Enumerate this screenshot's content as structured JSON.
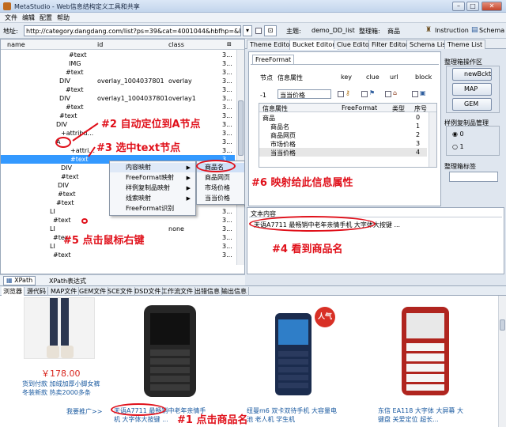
{
  "window": {
    "title": "MetaStudio - Web信息结构定义工具和共享"
  },
  "menu": [
    "文件",
    "编辑",
    "配置",
    "帮助"
  ],
  "toolbar": {
    "address_label": "地址:",
    "address_value": "http://category.dangdang.com/list?ps=39&cat=4001044&hbfhp=&lowp",
    "theme_label": "主题:",
    "theme_value": "demo_DD_list",
    "organizer_label": "整理箱:",
    "organizer_value": "商品",
    "instruction_label": "Instruction",
    "schema_label": "Schema"
  },
  "tree": {
    "headers": {
      "name": "name",
      "id": "id",
      "class": "class"
    },
    "rows": [
      {
        "name": "#text",
        "id": "",
        "class": "",
        "flag": "3..."
      },
      {
        "name": "IMG",
        "id": "",
        "class": "",
        "flag": "3..."
      },
      {
        "name": "#text",
        "id": "",
        "class": "",
        "flag": "3..."
      },
      {
        "name": "DIV",
        "id": "overlay_1004037801",
        "class": "overlay",
        "flag": "3..."
      },
      {
        "name": "#text",
        "id": "",
        "class": "",
        "flag": "3..."
      },
      {
        "name": "DIV",
        "id": "overlay1_1004037801",
        "class": "overlay1",
        "flag": "3..."
      },
      {
        "name": "#text",
        "id": "",
        "class": "",
        "flag": "3..."
      },
      {
        "name": "#text",
        "id": "",
        "class": "",
        "flag": "3..."
      },
      {
        "name": "DIV",
        "id": "",
        "class": "",
        "flag": "3..."
      },
      {
        "name": "+attribu...",
        "id": "",
        "class": "",
        "flag": "3..."
      },
      {
        "name": "A",
        "id": "",
        "class": "",
        "flag": "3..."
      },
      {
        "name": "+attri...",
        "id": "",
        "class": "",
        "flag": "3..."
      },
      {
        "name": "#text",
        "id": "",
        "class": "",
        "flag": "3..."
      },
      {
        "name": "DIV",
        "id": "",
        "class": "",
        "flag": "3..."
      },
      {
        "name": "#text",
        "id": "",
        "class": "",
        "flag": "3..."
      },
      {
        "name": "DIV",
        "id": "",
        "class": "",
        "flag": "3..."
      },
      {
        "name": "#text",
        "id": "",
        "class": "",
        "flag": "3..."
      },
      {
        "name": "#text",
        "id": "",
        "class": "",
        "flag": "3..."
      },
      {
        "name": "LI",
        "id": "",
        "class": "",
        "flag": "3..."
      },
      {
        "name": "#text",
        "id": "",
        "class": "",
        "flag": "3..."
      },
      {
        "name": "LI",
        "id": "",
        "class": "none",
        "flag": "3..."
      },
      {
        "name": "#tex",
        "id": "",
        "class": "",
        "flag": "3..."
      },
      {
        "name": "LI",
        "id": "",
        "class": "",
        "flag": "3..."
      },
      {
        "name": "#text",
        "id": "",
        "class": "",
        "flag": "3..."
      }
    ]
  },
  "context_menu": {
    "items": [
      "内容映射",
      "FreeFormat映射",
      "样例复制品映射",
      "线索映射",
      "FreeFormat识别"
    ],
    "submenu": [
      "商品名",
      "商品网页",
      "市场价格",
      "当当价格"
    ]
  },
  "left_bottom_tabs": [
    "XPath",
    "XPath表达式"
  ],
  "right_tabs": [
    "Theme Editor",
    "Bucket Editor",
    "Clue Editor",
    "Filter Editor",
    "Schema List",
    "Theme List"
  ],
  "bucket_editor": {
    "freeformat_tab": "FreeFormat",
    "cols": [
      "节点",
      "信息属性",
      "key",
      "clue",
      "url",
      "block"
    ],
    "row_index": "-1",
    "row_value": "当当价格",
    "table_headers": [
      "信息属性",
      "FreeFormat",
      "类型",
      "序号"
    ],
    "table_rows": [
      {
        "name": "商品",
        "type": "",
        "seq": "0"
      },
      {
        "name": "商品名",
        "type": "",
        "seq": "1"
      },
      {
        "name": "商品网页",
        "type": "",
        "seq": "2"
      },
      {
        "name": "市场价格",
        "type": "",
        "seq": "3"
      },
      {
        "name": "当当价格",
        "type": "",
        "seq": "4"
      }
    ]
  },
  "organizer_panel": {
    "title": "整理箱操作区",
    "buttons": [
      "newBckt",
      "MAP",
      "GEM"
    ],
    "sample_title": "样例复制品管理",
    "radio_0": "0",
    "radio_1": "1",
    "tag_title": "整理箱标签"
  },
  "text_content": {
    "title": "文本内容",
    "value": "天语A7711 最畅销中老年亲情手机 大字体大按键 ..."
  },
  "browser_tabs": [
    "浏览器",
    "源代码",
    "MAP文件",
    "GEM文件",
    "SCE文件",
    "DSD文件",
    "工作流文件",
    "出错信息",
    "输出信息"
  ],
  "products": [
    {
      "price": "￥178.00",
      "line1": "货到付款 加绒加厚小脚女裤",
      "line2": "冬装新款 热卖2000多条",
      "more": "我要推广>>",
      "badge": ""
    },
    {
      "price": "",
      "line1": "天语A7711 最畅销中老年亲情手",
      "line2": "机 大字体大按键 ...",
      "more": "",
      "badge": ""
    },
    {
      "price": "",
      "line1": "纽曼m6 双卡双待手机 大容量电",
      "line2": "池 老人机 学生机",
      "more": "",
      "badge": "人气"
    },
    {
      "price": "",
      "line1": "东信 EA118 大字体 大屏幕 大",
      "line2": "键盘 关爱定位 超长...",
      "more": "",
      "badge": ""
    }
  ],
  "annotations": {
    "a1": "#1  点击商品名",
    "a2": "#2  自动定位到A节点",
    "a3": "#3  选中text节点",
    "a4": "#4  看到商品名",
    "a5": "#5  点击鼠标右键",
    "a6": "#6  映射给此信息属性"
  }
}
